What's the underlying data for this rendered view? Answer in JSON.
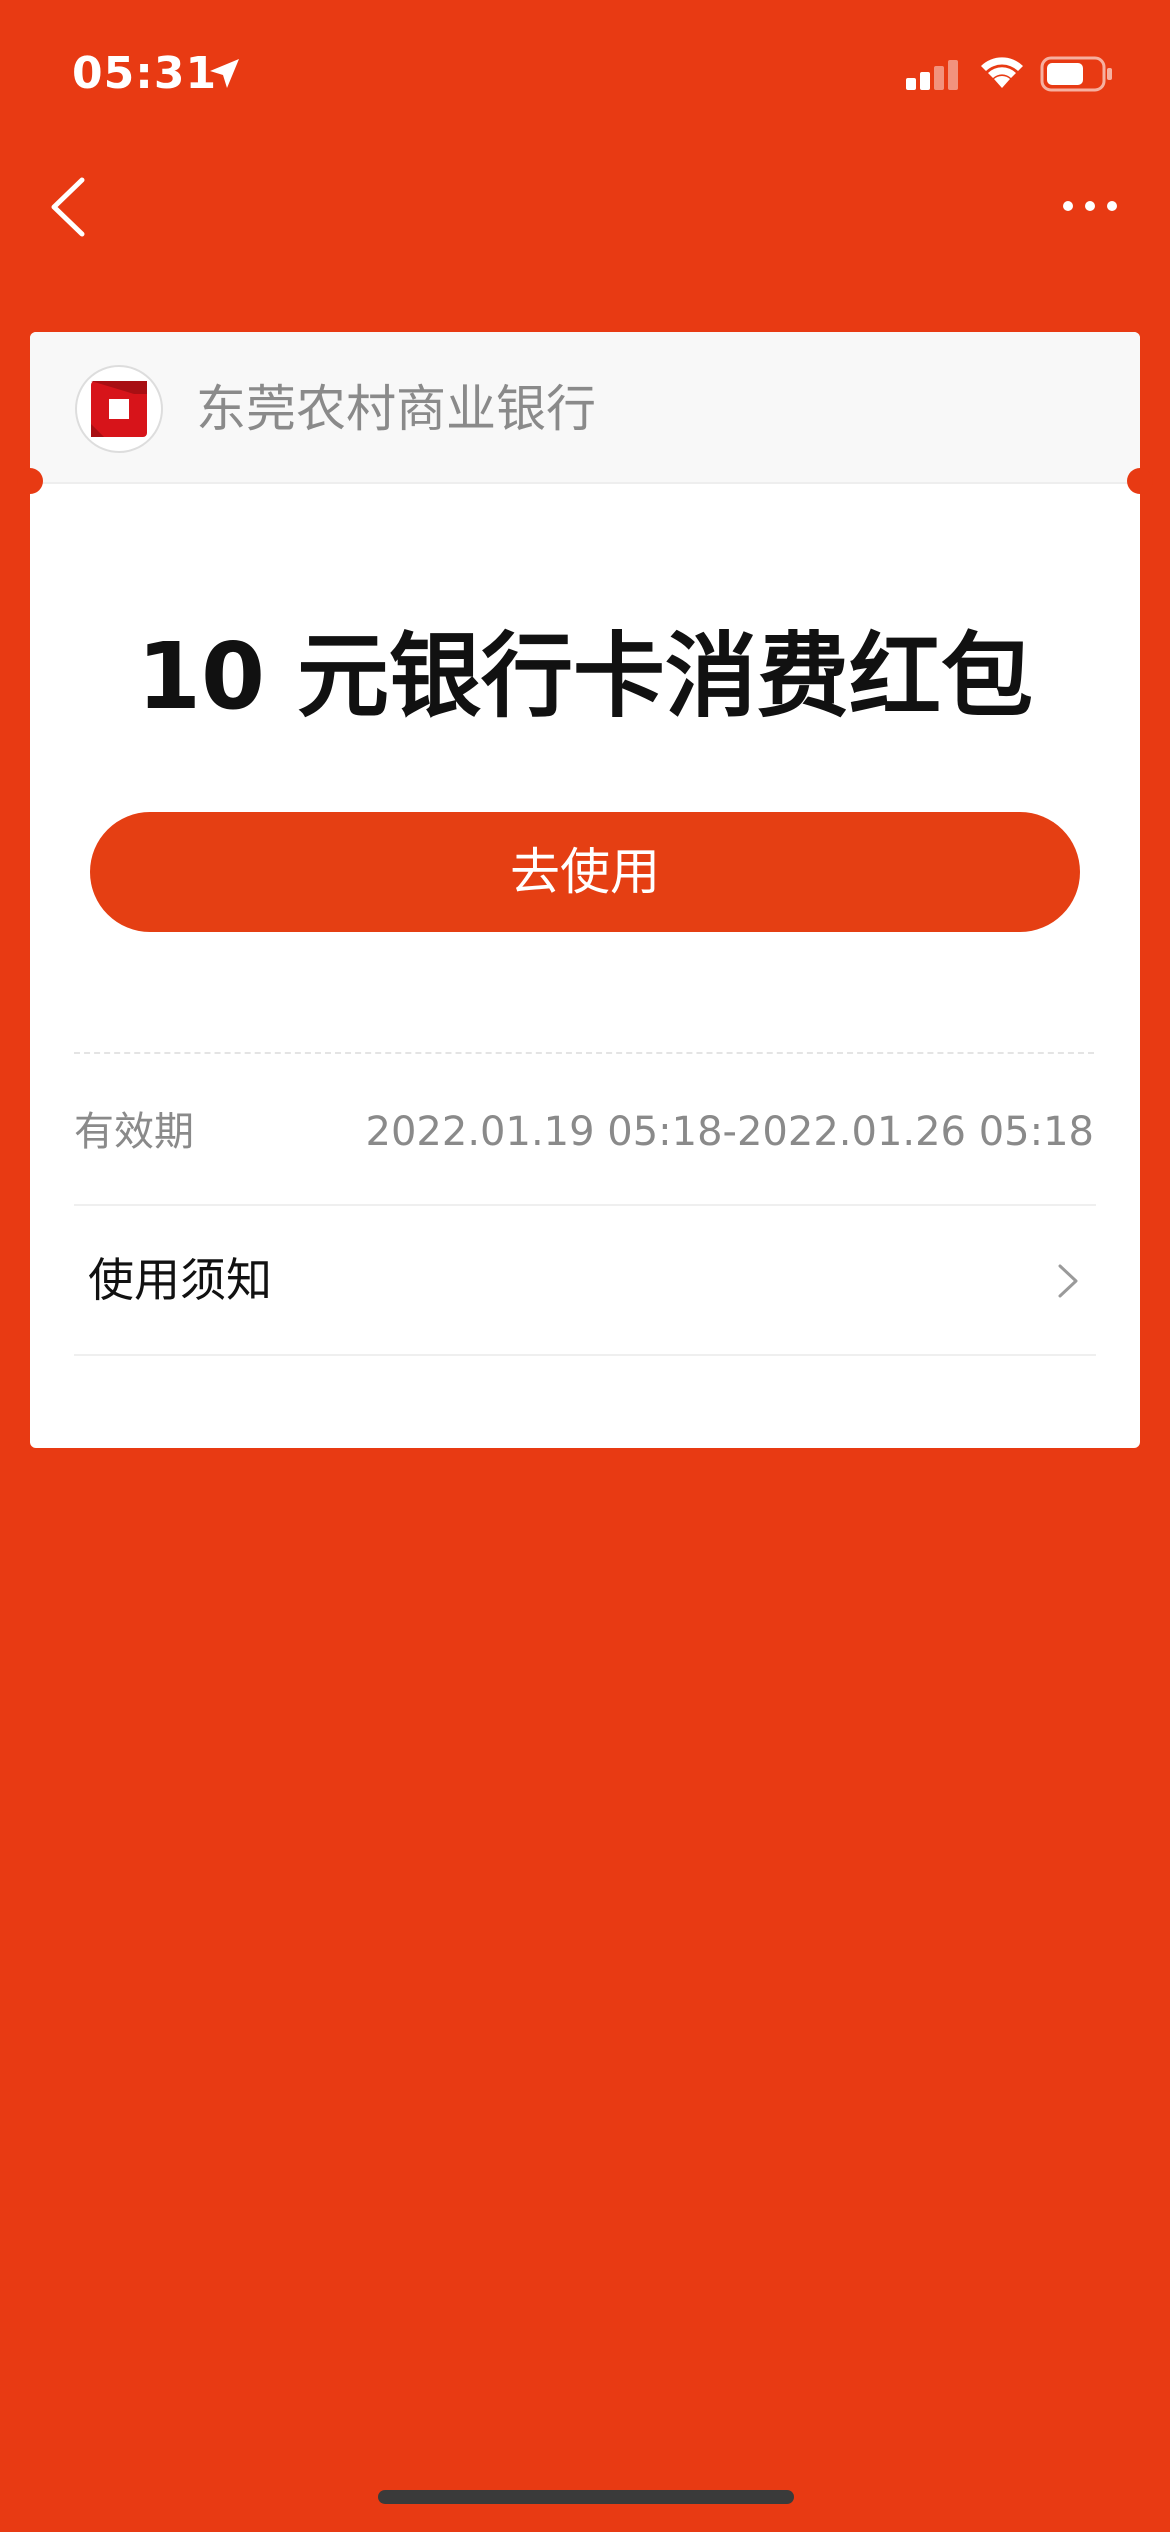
{
  "status_bar": {
    "time": "05:31",
    "icons": [
      "location-arrow-icon",
      "cellular-signal-icon",
      "wifi-icon",
      "battery-icon"
    ]
  },
  "nav": {
    "back_icon": "chevron-left-icon",
    "more_icon": "more-dots-icon"
  },
  "card": {
    "bank_name": "东莞农村商业银行",
    "bank_logo_icon": "bank-logo-icon",
    "coupon_title": "10 元银行卡消费红包",
    "use_button_label": "去使用",
    "validity": {
      "label": "有效期",
      "value": "2022.01.19 05:18-2022.01.26 05:18"
    },
    "notice": {
      "label": "使用须知",
      "icon": "chevron-right-icon"
    }
  },
  "colors": {
    "background": "#E83A13",
    "button": "#E53F13",
    "card": "#FFFFFF",
    "header": "#F8F8F8",
    "logo_red": "#D7141A"
  }
}
